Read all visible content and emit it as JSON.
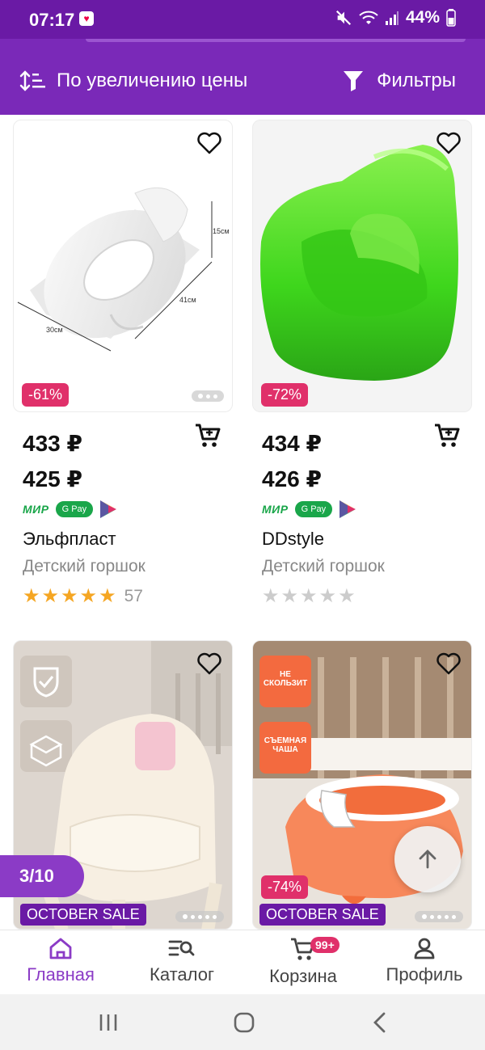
{
  "status_bar": {
    "time": "07:17",
    "battery": "44%",
    "icons": [
      "mute-icon",
      "wifi-icon",
      "signal-icon",
      "battery-icon"
    ]
  },
  "toolbar": {
    "sort_label": "По увеличению цены",
    "filter_label": "Фильтры"
  },
  "products": [
    {
      "discount": "-61%",
      "old_price": "433 ₽",
      "price": "425 ₽",
      "brand": "Эльфпласт",
      "category": "Детский горшок",
      "rating": 5,
      "reviews": "57",
      "dims": [
        "15см",
        "41см",
        "30см"
      ]
    },
    {
      "discount": "-72%",
      "old_price": "434 ₽",
      "price": "426 ₽",
      "brand": "DDstyle",
      "category": "Детский горшок",
      "rating": 0,
      "reviews": ""
    },
    {
      "sale_label": "OCTOBER SALE"
    },
    {
      "discount": "-74%",
      "sale_label": "OCTOBER SALE",
      "badges": [
        "НЕ СКОЛЬЗИТ",
        "СЪЕМНАЯ ЧАША"
      ]
    }
  ],
  "payments": {
    "mir": "МИР",
    "gpay": "G Pay"
  },
  "pager": "3/10",
  "bottom_nav": {
    "home": "Главная",
    "catalog": "Каталог",
    "cart": "Корзина",
    "cart_badge": "99+",
    "profile": "Профиль"
  },
  "colors": {
    "brand": "#7a29b8",
    "accent": "#8b3bc6",
    "discount": "#e0306a",
    "star": "#f5a623"
  }
}
